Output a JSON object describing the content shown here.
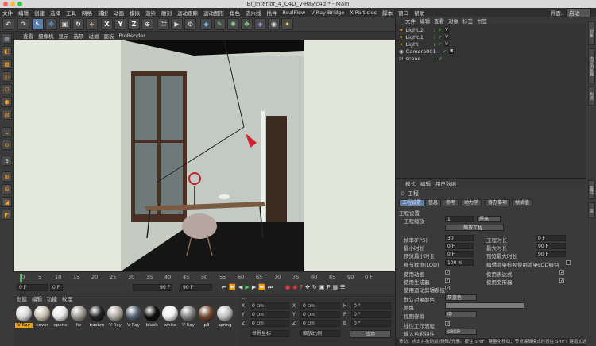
{
  "window": {
    "title": "BI_Interior_4_C4D_V-Ray.c4d * - Main"
  },
  "menu": {
    "items": [
      "文件",
      "编辑",
      "创建",
      "选择",
      "工具",
      "网格",
      "捕捉",
      "动画",
      "模拟",
      "渲染",
      "雕刻",
      "运动跟踪",
      "运动图形",
      "角色",
      "流水线",
      "插件",
      "RealFlow",
      "V-Ray Bridge",
      "X-Particles",
      "脚本",
      "窗口",
      "帮助"
    ],
    "layout_label": "界面:",
    "layout_value": "启动"
  },
  "toolbar": {
    "axis_x": "X",
    "axis_y": "Y",
    "axis_z": "Z"
  },
  "viewport": {
    "menu": [
      "查看",
      "摄像机",
      "显示",
      "选项",
      "过滤",
      "面板",
      "ProRender"
    ]
  },
  "timeline": {
    "ticks": [
      "0",
      "5",
      "10",
      "15",
      "20",
      "25",
      "30",
      "35",
      "40",
      "45",
      "50",
      "55",
      "60",
      "65",
      "70",
      "75",
      "80",
      "85",
      "90"
    ],
    "frame_end_label": "0 F",
    "start_field": "0 F",
    "current_field": "0 F",
    "end_field": "90 F",
    "end_field2": "90 F"
  },
  "materials": {
    "menu": [
      "创建",
      "编辑",
      "功能",
      "纹理"
    ],
    "items": [
      {
        "label": "V-Ray",
        "color": "#d8d8d8"
      },
      {
        "label": "cover",
        "color": "#c8c0b0"
      },
      {
        "label": "opene",
        "color": "#e8e8e8"
      },
      {
        "label": "fw",
        "color": "#a09a90"
      },
      {
        "label": "bookm",
        "color": "#222222"
      },
      {
        "label": "V-Ray",
        "color": "#b0a8a0"
      },
      {
        "label": "V-Ray",
        "color": "#556070"
      },
      {
        "label": "black",
        "color": "#111111"
      },
      {
        "label": "white",
        "color": "#f0f0f0"
      },
      {
        "label": "V-Ray",
        "color": "#808080"
      },
      {
        "label": "p3",
        "color": "#704830"
      },
      {
        "label": "spring",
        "color": "#c0c0c0"
      }
    ]
  },
  "coords": {
    "x": "0 cm",
    "y": "0 cm",
    "z": "0 cm",
    "sx": "0 cm",
    "sy": "0 cm",
    "sz": "0 cm",
    "h": "0 °",
    "p": "0 °",
    "b": "0 °",
    "mode": "世界坐标",
    "scale_mode": "缩放比例",
    "apply": "应用"
  },
  "objects": {
    "menu": [
      "文件",
      "编辑",
      "查看",
      "对象",
      "标签",
      "书签"
    ],
    "items": [
      "Light.2",
      "Light.1",
      "Light",
      "Camera001",
      "scene"
    ]
  },
  "attributes": {
    "menu": [
      "模式",
      "编辑",
      "用户数据"
    ],
    "title": "工程",
    "tabs": [
      "工程设置",
      "信息",
      "参考",
      "动力学",
      "待办事项",
      "帧插值"
    ],
    "section": "工程设置",
    "scale_label": "工程缩放",
    "scale_value": "1",
    "scale_unit": "厘米",
    "scale_button": "缩放工程...",
    "fps_label": "帧率(FPS)",
    "fps_value": "30",
    "duration_label": "工程时长",
    "duration_value": "0 F",
    "min_label": "最小时长",
    "min_value": "0 F",
    "max_label": "最大时长",
    "max_value": "90 F",
    "pmin_label": "预览最小时长",
    "pmin_value": "0 F",
    "pmax_label": "预览最大时长",
    "pmax_value": "90 F",
    "lod_label": "细节程度(LOD)",
    "lod_value": "100 %",
    "lod_edit_label": "编辑渲染检视使用渲染LOD级别",
    "use_anim": "使用动画",
    "use_expr": "使用表达式",
    "use_gen": "使用生成器",
    "use_deform": "使用变形器",
    "use_motion": "使用运动剪辑系统",
    "default_color_label": "默认对象颜色",
    "default_color_value": "灰蓝色",
    "color_label": "颜色",
    "view_clip_label": "视图修剪",
    "view_clip_value": "中",
    "linear_label": "线性工作流程",
    "input_color_label": "输入色彩特性",
    "input_color_value": "sRGB"
  },
  "status": {
    "text": "移动：点击并拖动鼠标移动元素。按住 SHIFT 键量化移动；节点编辑模式时按住 SHIFT 键增加选择对象；按住 CTRL 键减少选择对象。"
  },
  "right_tabs": [
    "对象",
    "内容浏览器",
    "构造",
    "属性",
    "层"
  ]
}
